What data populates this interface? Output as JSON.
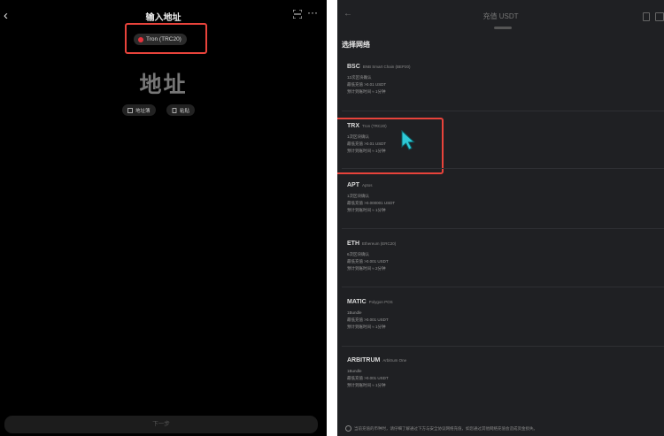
{
  "left": {
    "back_icon": "chevron-left-icon",
    "title": "输入地址",
    "scan_icon": "scan-icon",
    "more_icon": "more-icon",
    "network_label": "Tron (TRC20)",
    "network_icon_color": "#e8323c",
    "address_placeholder": "地址",
    "address_book_label": "地址簿",
    "paste_label": "粘贴",
    "next_label": "下一步"
  },
  "right": {
    "title": "充值 USDT",
    "sheet_title": "选择网络",
    "networks": [
      {
        "code": "BSC",
        "name": "BNB Smart Chain (BEP20)",
        "confirm": "12次区块确认",
        "min": "最低充值 >0.01 USDT",
        "eta": "预计到账时间 ≈ 1分钟"
      },
      {
        "code": "TRX",
        "name": "Tron (TRC20)",
        "confirm": "1次区块确认",
        "min": "最低充值 >0.01 USDT",
        "eta": "预计到账时间 ≈ 1分钟"
      },
      {
        "code": "APT",
        "name": "Aptos",
        "confirm": "1次区块确认",
        "min": "最低充值 >0.000001 USDT",
        "eta": "预计到账时间 ≈ 1分钟"
      },
      {
        "code": "ETH",
        "name": "Ethereum (ERC20)",
        "confirm": "6次区块确认",
        "min": "最低充值 >0.001 USDT",
        "eta": "预计到账时间 ≈ 2分钟"
      },
      {
        "code": "MATIC",
        "name": "Polygon POS",
        "confirm": "1Bundle",
        "min": "最低充值 >0.001 USDT",
        "eta": "预计到账时间 ≈ 1分钟"
      },
      {
        "code": "ARBITRUM",
        "name": "Arbitrum One",
        "confirm": "1Bundle",
        "min": "最低充值 >0.001 USDT",
        "eta": "预计到账时间 ≈ 1分钟"
      }
    ],
    "footer_note": "当前充值的币种时，请仔细了解通过下方与安全协议网络充值，如您通过其他网络充值会造成资金损失。"
  },
  "colors": {
    "highlight": "#e8433b",
    "cursor": "#2ec9d6"
  }
}
